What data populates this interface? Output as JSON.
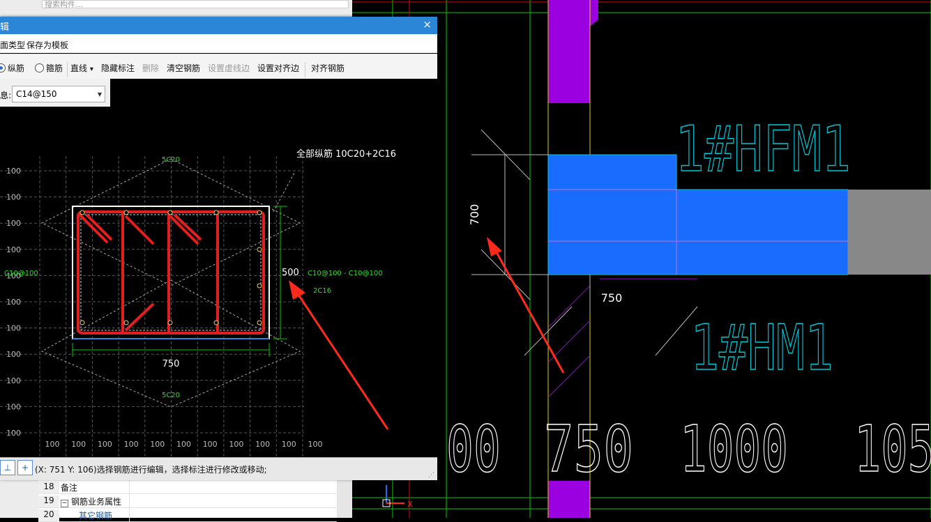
{
  "left_panel": {
    "search_placeholder": "搜索构件...",
    "property_rows": [
      {
        "num": "18",
        "label": "备注"
      },
      {
        "num": "19",
        "label": "钢筋业务属性",
        "expander": "−"
      },
      {
        "num": "20",
        "label": "其它钢筋"
      }
    ]
  },
  "dialog": {
    "title": "辑",
    "close_label": "×",
    "menu": [
      "面类型",
      "保存为模板"
    ],
    "toolbar": {
      "radio_longitudinal": "纵筋",
      "radio_stirrup": "箍筋",
      "line_mode": "直线",
      "hide_annotation": "隐藏标注",
      "delete": "删除",
      "clear_rebar": "清空钢筋",
      "set_dashed_edge": "设置虚线边",
      "set_align_edge": "设置对齐边",
      "align_rebar": "对齐钢筋"
    },
    "info_label": "息:",
    "rebar_value": "C14@150",
    "status_text": "(X: 751 Y: 106)选择钢筋进行编辑，选择标注进行修改或移动;",
    "status_buttons": [
      "⊥",
      "+"
    ]
  },
  "section": {
    "all_longitudinal": "全部纵筋 10C20+2C16",
    "top_label": "5C20",
    "bottom_label": "5C20",
    "left_label": "C10@100",
    "right_label": "C10@100 - C10@100",
    "side_label": "2C16",
    "width_dim": "750",
    "height_dim": "500",
    "grid_label": "100"
  },
  "cad": {
    "label_hfm": "1#HFM1",
    "label_hm": "1#HM1",
    "dim_700": "700",
    "dim_750": "750",
    "big_dims": [
      "00",
      "750",
      "1000",
      "105"
    ],
    "axis_x": "X"
  },
  "colors": {
    "accent": "#2b86d8",
    "rebar": "#e02020",
    "beam_blue": "#1a6cff",
    "cyan": "#00c8d6",
    "purple": "#9b00e0",
    "green": "#00cc00",
    "annotation_red": "#ff2a1a"
  }
}
